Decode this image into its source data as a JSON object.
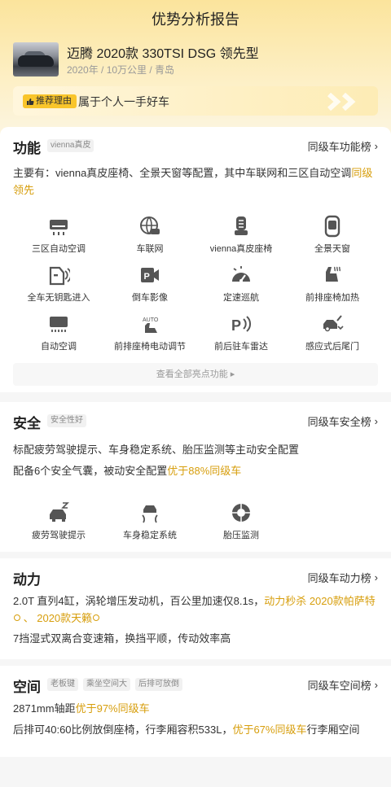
{
  "header": {
    "title": "优势分析报告"
  },
  "car": {
    "name": "迈腾 2020款 330TSI DSG 领先型",
    "meta": "2020年 / 10万公里 / 青岛"
  },
  "reason": {
    "badge": "推荐理由",
    "text": "属于个人一手好车"
  },
  "features": {
    "title": "功能",
    "tag": "vienna真皮",
    "rank": "同级车功能榜",
    "desc_prefix": "主要有：vienna真皮座椅、全景天窗等配置，其中车联网和三区自动空调",
    "desc_hl": "同级领先",
    "items": [
      {
        "label": "三区自动空调",
        "icon": "air-conditioner-icon"
      },
      {
        "label": "车联网",
        "icon": "connected-car-icon"
      },
      {
        "label": "vienna真皮座椅",
        "icon": "leather-seat-icon"
      },
      {
        "label": "全景天窗",
        "icon": "sunroof-icon"
      },
      {
        "label": "全车无钥匙进入",
        "icon": "keyless-entry-icon"
      },
      {
        "label": "倒车影像",
        "icon": "reverse-camera-icon"
      },
      {
        "label": "定速巡航",
        "icon": "cruise-control-icon"
      },
      {
        "label": "前排座椅加热",
        "icon": "seat-heating-icon"
      },
      {
        "label": "自动空调",
        "icon": "auto-ac-icon"
      },
      {
        "label": "前排座椅电动调节",
        "icon": "power-seat-icon"
      },
      {
        "label": "前后驻车雷达",
        "icon": "parking-radar-icon"
      },
      {
        "label": "感应式后尾门",
        "icon": "power-tailgate-icon"
      }
    ],
    "more": "查看全部亮点功能 ▸"
  },
  "safety": {
    "title": "安全",
    "tag": "安全性好",
    "rank": "同级车安全榜",
    "line1": "标配疲劳驾驶提示、车身稳定系统、胎压监测等主动安全配置",
    "line2_prefix": "配备6个安全气囊，被动安全配置",
    "line2_hl": "优于88%同级车",
    "items": [
      {
        "label": "疲劳驾驶提示",
        "icon": "fatigue-warning-icon"
      },
      {
        "label": "车身稳定系统",
        "icon": "stability-control-icon"
      },
      {
        "label": "胎压监测",
        "icon": "tire-pressure-icon"
      }
    ]
  },
  "power": {
    "title": "动力",
    "rank": "同级车动力榜",
    "line1_prefix": "2.0T 直列4缸，涡轮增压发动机，百公里加速仅8.1s，",
    "line1_hl1": "动力秒杀 2020款帕萨特",
    "line1_sep": " 、 ",
    "line1_hl2": "2020款天籁",
    "line2": "7挡湿式双离合变速箱，换挡平顺，传动效率高"
  },
  "space": {
    "title": "空间",
    "tags": [
      "老板键",
      "乘坐空间大",
      "后排可放倒"
    ],
    "rank": "同级车空间榜",
    "line1_prefix": "2871mm轴距",
    "line1_hl": "优于97%同级车",
    "line2_prefix": "后排可40:60比例放倒座椅，行李厢容积533L，",
    "line2_hl": "优于67%同级车",
    "line2_suffix": "行李厢空间"
  }
}
